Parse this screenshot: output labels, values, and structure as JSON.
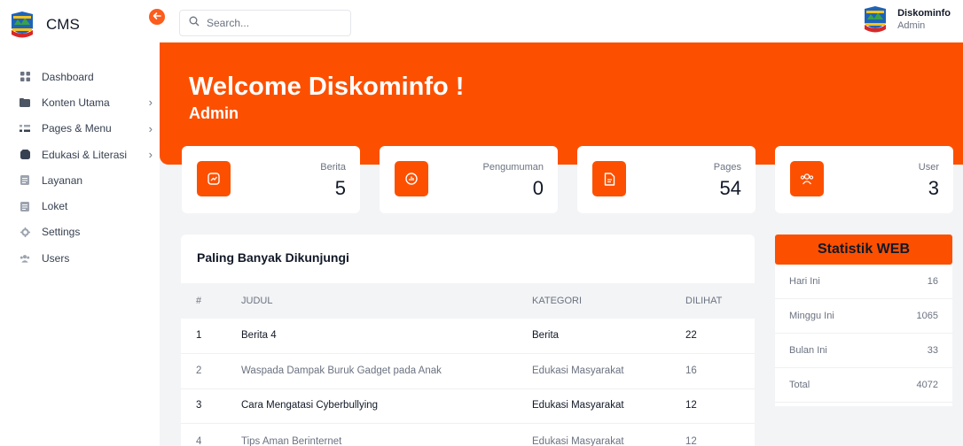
{
  "sidebar": {
    "brand": "CMS",
    "items": [
      {
        "label": "Dashboard",
        "icon": "grid-icon",
        "chevron": ""
      },
      {
        "label": "Konten Utama",
        "icon": "folder-icon",
        "chevron": "›"
      },
      {
        "label": "Pages & Menu",
        "icon": "menu-icon",
        "chevron": "›"
      },
      {
        "label": "Edukasi & Literasi",
        "icon": "book-icon",
        "chevron": "›"
      },
      {
        "label": "Layanan",
        "icon": "document-icon",
        "chevron": ""
      },
      {
        "label": "Loket",
        "icon": "document-icon",
        "chevron": ""
      },
      {
        "label": "Settings",
        "icon": "gear-icon",
        "chevron": ""
      },
      {
        "label": "Users",
        "icon": "users-icon",
        "chevron": ""
      }
    ]
  },
  "topbar": {
    "search_placeholder": "Search...",
    "user_name": "Diskominfo",
    "user_role": "Admin"
  },
  "hero": {
    "title": "Welcome Diskominfo !",
    "subtitle": "Admin"
  },
  "cards": [
    {
      "label": "Berita",
      "value": "5",
      "icon": "chart-trend-icon"
    },
    {
      "label": "Pengumuman",
      "value": "0",
      "icon": "bar-chart-icon"
    },
    {
      "label": "Pages",
      "value": "54",
      "icon": "file-icon"
    },
    {
      "label": "User",
      "value": "3",
      "icon": "users-icon"
    }
  ],
  "table": {
    "title": "Paling Banyak Dikunjungi",
    "headers": {
      "no": "#",
      "title": "JUDUL",
      "category": "KATEGORI",
      "views": "DILIHAT"
    },
    "rows": [
      {
        "no": "1",
        "title": "Berita 4",
        "category": "Berita",
        "views": "22"
      },
      {
        "no": "2",
        "title": "Waspada Dampak Buruk Gadget pada Anak",
        "category": "Edukasi Masyarakat",
        "views": "16"
      },
      {
        "no": "3",
        "title": "Cara Mengatasi Cyberbullying",
        "category": "Edukasi Masyarakat",
        "views": "12"
      },
      {
        "no": "4",
        "title": "Tips Aman Berinternet",
        "category": "Edukasi Masyarakat",
        "views": "12"
      }
    ]
  },
  "stats": {
    "title": "Statistik WEB",
    "rows": [
      {
        "label": "Hari Ini",
        "value": "16"
      },
      {
        "label": "Minggu Ini",
        "value": "1065"
      },
      {
        "label": "Bulan Ini",
        "value": "33"
      },
      {
        "label": "Total",
        "value": "4072"
      }
    ]
  },
  "colors": {
    "accent": "#fc5000",
    "background": "#f3f4f6"
  }
}
